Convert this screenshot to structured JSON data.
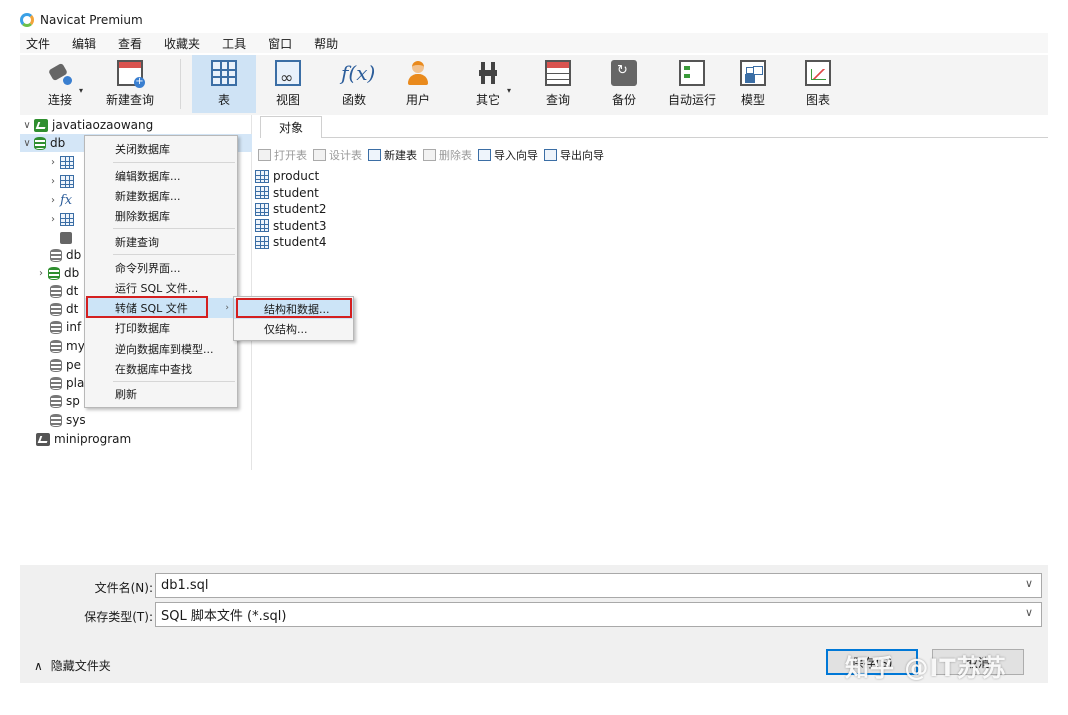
{
  "app": {
    "title": "Navicat Premium"
  },
  "menu": [
    "文件",
    "编辑",
    "查看",
    "收藏夹",
    "工具",
    "窗口",
    "帮助"
  ],
  "toolbar": [
    {
      "label": "连接",
      "icon": "plug-connect-icon"
    },
    {
      "label": "新建查询",
      "icon": "new-query-icon"
    },
    {
      "label": "表",
      "icon": "table-icon",
      "active": true
    },
    {
      "label": "视图",
      "icon": "view-icon"
    },
    {
      "label": "函数",
      "icon": "function-fx-icon"
    },
    {
      "label": "用户",
      "icon": "user-icon"
    },
    {
      "label": "其它",
      "icon": "tools-icon"
    },
    {
      "label": "查询",
      "icon": "query-icon"
    },
    {
      "label": "备份",
      "icon": "backup-icon"
    },
    {
      "label": "自动运行",
      "icon": "auto-run-icon"
    },
    {
      "label": "模型",
      "icon": "model-icon"
    },
    {
      "label": "图表",
      "icon": "chart-icon"
    }
  ],
  "tree": {
    "connection": "javatiaozaowang",
    "databases": [
      "db",
      "db",
      "db",
      "dt",
      "dt",
      "inf",
      "my",
      "pe",
      "pla",
      "sp",
      "sys"
    ],
    "second_connection": "miniprogram"
  },
  "objects": {
    "tab_label": "对象",
    "actions": [
      {
        "label": "打开表",
        "enabled": false
      },
      {
        "label": "设计表",
        "enabled": false
      },
      {
        "label": "新建表",
        "enabled": true
      },
      {
        "label": "删除表",
        "enabled": false
      },
      {
        "label": "导入向导",
        "enabled": true
      },
      {
        "label": "导出向导",
        "enabled": true
      }
    ],
    "tables": [
      "product",
      "student",
      "student2",
      "student3",
      "student4"
    ]
  },
  "context_menu": {
    "items": [
      "关闭数据库",
      "编辑数据库...",
      "新建数据库...",
      "删除数据库",
      "新建查询",
      "命令列界面...",
      "运行 SQL 文件...",
      "转储 SQL 文件",
      "打印数据库",
      "逆向数据库到模型...",
      "在数据库中查找",
      "刷新"
    ],
    "submenu": [
      "结构和数据...",
      "仅结构..."
    ]
  },
  "save_dialog": {
    "filename_label": "文件名(N):",
    "filename_value": "db1.sql",
    "filetype_label": "保存类型(T):",
    "filetype_value": "SQL 脚本文件 (*.sql)",
    "hide_folders": "隐藏文件夹",
    "save_button": "保存(S)",
    "cancel_button": "取消"
  },
  "watermark": "知乎 @IT苏苏",
  "colors": {
    "highlight": "#cce4f7",
    "callout_red": "#d42020",
    "selection": "#d4e6f7"
  }
}
